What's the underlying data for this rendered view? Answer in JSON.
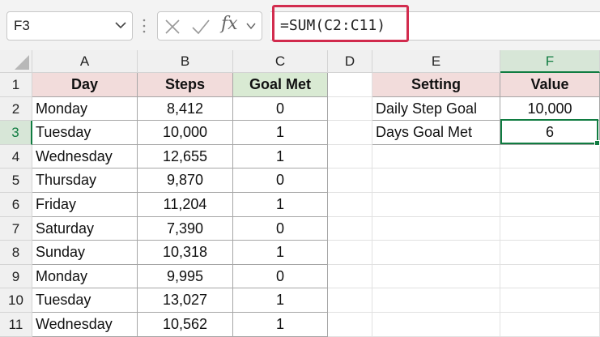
{
  "formula_bar": {
    "name_box": "F3",
    "fx": "fx",
    "formula": "=SUM(C2:C11)"
  },
  "columns": [
    "A",
    "B",
    "C",
    "D",
    "E",
    "F"
  ],
  "rows": [
    "1",
    "2",
    "3",
    "4",
    "5",
    "6",
    "7",
    "8",
    "9",
    "10",
    "11"
  ],
  "table1": {
    "headers": [
      "Day",
      "Steps",
      "Goal Met"
    ],
    "rows": [
      [
        "Monday",
        "8,412",
        "0"
      ],
      [
        "Tuesday",
        "10,000",
        "1"
      ],
      [
        "Wednesday",
        "12,655",
        "1"
      ],
      [
        "Thursday",
        "9,870",
        "0"
      ],
      [
        "Friday",
        "11,204",
        "1"
      ],
      [
        "Saturday",
        "7,390",
        "0"
      ],
      [
        "Sunday",
        "10,318",
        "1"
      ],
      [
        "Monday",
        "9,995",
        "0"
      ],
      [
        "Tuesday",
        "13,027",
        "1"
      ],
      [
        "Wednesday",
        "10,562",
        "1"
      ]
    ]
  },
  "table2": {
    "headers": [
      "Setting",
      "Value"
    ],
    "rows": [
      [
        "Daily Step Goal",
        "10,000"
      ],
      [
        "Days Goal Met",
        "6"
      ]
    ]
  },
  "colors": {
    "header_pink": "#f2dcdb",
    "header_green": "#d9ead3",
    "selection_green": "#107c41",
    "highlight_red": "#d22c4e"
  },
  "icons": {
    "name_box_dropdown": "chevron-down-icon",
    "cancel": "close-icon",
    "enter": "check-icon",
    "expand": "chevron-down-icon"
  }
}
